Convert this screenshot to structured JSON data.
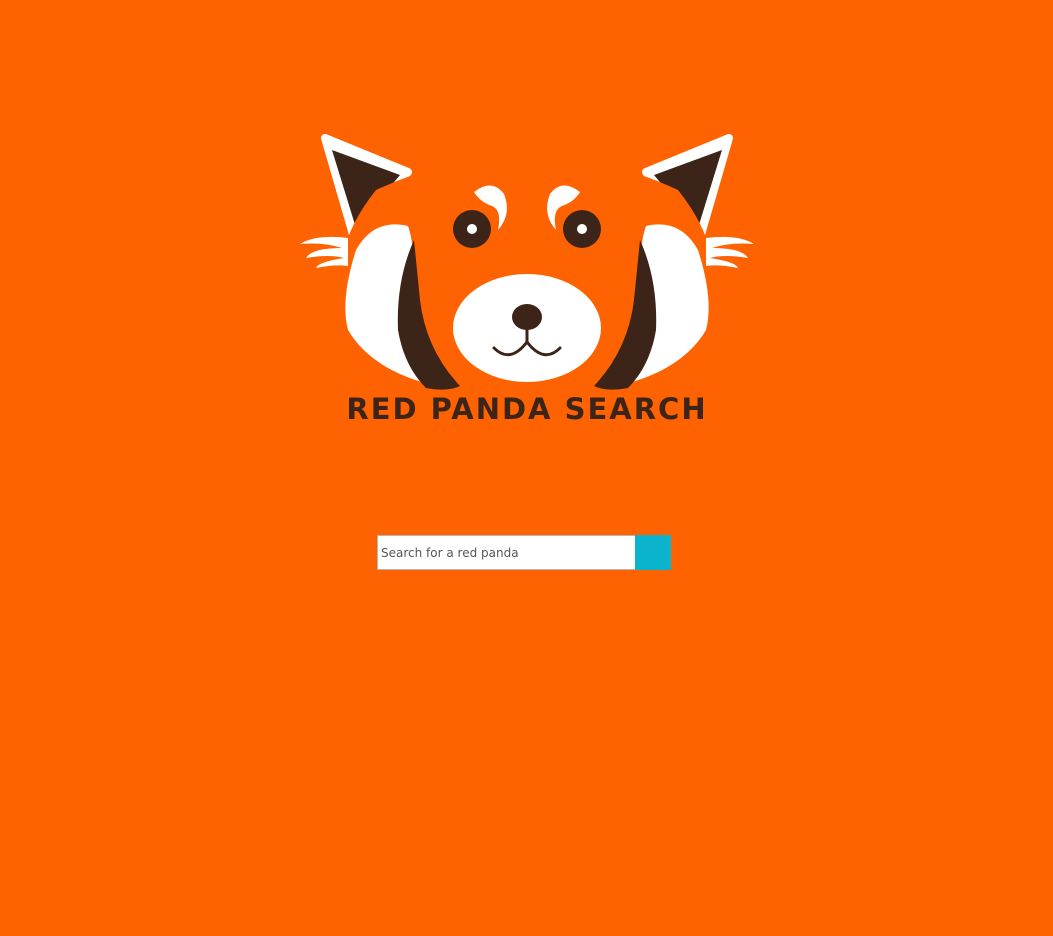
{
  "logo": {
    "wordmark": "RED PANDA SEARCH",
    "icon": "red-panda-face-icon"
  },
  "search": {
    "placeholder": "Search for a red panda",
    "value": "",
    "button_label": "",
    "button_icon": "none"
  },
  "colors": {
    "background": "#ff6200",
    "panda_dark": "#3d2418",
    "panda_white": "#ffffff",
    "button": "#0bb4cc"
  }
}
